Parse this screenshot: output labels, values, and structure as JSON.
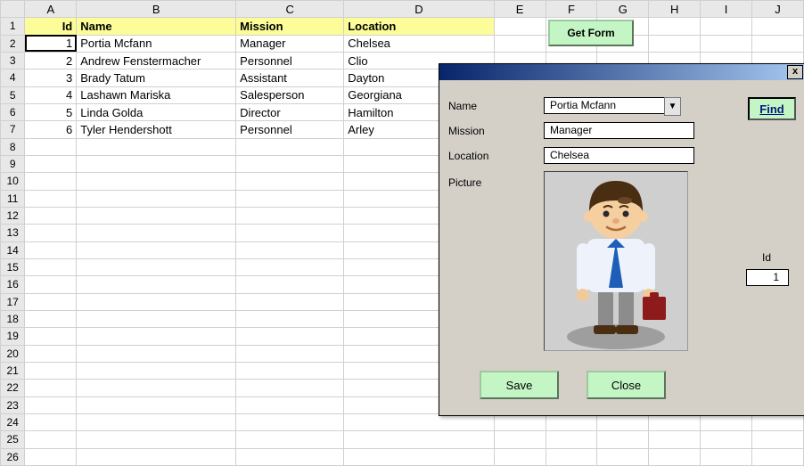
{
  "columns": [
    "A",
    "B",
    "C",
    "D",
    "E",
    "F",
    "G",
    "H",
    "I",
    "J"
  ],
  "rowCount": 26,
  "headers": {
    "id": "Id",
    "name": "Name",
    "mission": "Mission",
    "location": "Location"
  },
  "rows": [
    {
      "id": 1,
      "name": "Portia Mcfann",
      "mission": "Manager",
      "location": "Chelsea"
    },
    {
      "id": 2,
      "name": "Andrew Fenstermacher",
      "mission": "Personnel",
      "location": "Clio"
    },
    {
      "id": 3,
      "name": "Brady Tatum",
      "mission": "Assistant",
      "location": "Dayton"
    },
    {
      "id": 4,
      "name": "Lashawn Mariska",
      "mission": "Salesperson",
      "location": "Georgiana"
    },
    {
      "id": 5,
      "name": "Linda Golda",
      "mission": "Director",
      "location": "Hamilton"
    },
    {
      "id": 6,
      "name": "Tyler Hendershott",
      "mission": "Personnel",
      "location": "Arley"
    }
  ],
  "getFormBtn": "Get Form",
  "form": {
    "labels": {
      "name": "Name",
      "mission": "Mission",
      "location": "Location",
      "picture": "Picture",
      "id": "Id"
    },
    "values": {
      "name": "Portia Mcfann",
      "mission": "Manager",
      "location": "Chelsea",
      "id": "1"
    },
    "buttons": {
      "find": "Find",
      "save": "Save",
      "close": "Close"
    },
    "closeX": "x"
  }
}
